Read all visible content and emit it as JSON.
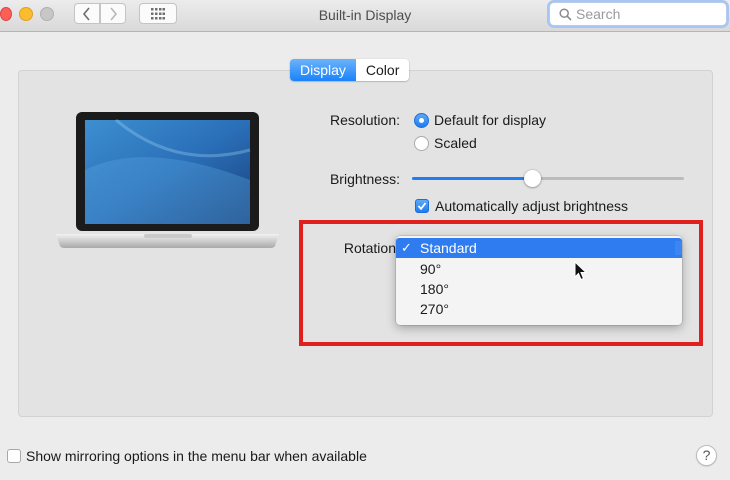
{
  "window": {
    "title": "Built-in Display"
  },
  "search": {
    "placeholder": "Search",
    "value": ""
  },
  "tabs": [
    {
      "label": "Display",
      "active": true
    },
    {
      "label": "Color",
      "active": false
    }
  ],
  "resolution": {
    "label": "Resolution:",
    "options": [
      {
        "label": "Default for display",
        "selected": true
      },
      {
        "label": "Scaled",
        "selected": false
      }
    ]
  },
  "brightness": {
    "label": "Brightness:",
    "level": 0.44,
    "auto_label": "Automatically adjust brightness",
    "auto_checked": true
  },
  "rotation": {
    "label": "Rotation",
    "options": [
      {
        "label": "Standard",
        "selected": true
      },
      {
        "label": "90°",
        "selected": false
      },
      {
        "label": "180°",
        "selected": false
      },
      {
        "label": "270°",
        "selected": false
      }
    ]
  },
  "mirroring": {
    "label": "Show mirroring options in the menu bar when available",
    "checked": false
  },
  "help": {
    "label": "?"
  },
  "colors": {
    "accent": "#1f7ff2",
    "highlight_box": "#e0201f"
  },
  "icons": [
    "back-icon",
    "forward-icon",
    "grid-icon",
    "search-icon",
    "checkmark-icon",
    "help-icon",
    "pointer-cursor-icon"
  ]
}
